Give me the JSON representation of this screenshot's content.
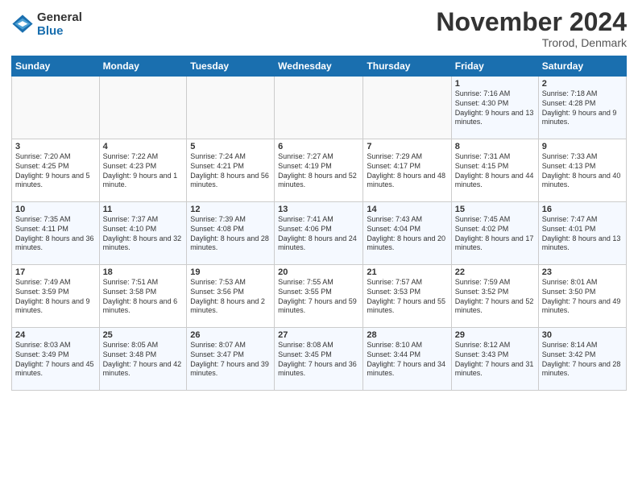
{
  "logo": {
    "general": "General",
    "blue": "Blue"
  },
  "title": "November 2024",
  "location": "Trorod, Denmark",
  "days_header": [
    "Sunday",
    "Monday",
    "Tuesday",
    "Wednesday",
    "Thursday",
    "Friday",
    "Saturday"
  ],
  "weeks": [
    [
      {
        "day": "",
        "data": ""
      },
      {
        "day": "",
        "data": ""
      },
      {
        "day": "",
        "data": ""
      },
      {
        "day": "",
        "data": ""
      },
      {
        "day": "",
        "data": ""
      },
      {
        "day": "1",
        "data": "Sunrise: 7:16 AM\nSunset: 4:30 PM\nDaylight: 9 hours and 13 minutes."
      },
      {
        "day": "2",
        "data": "Sunrise: 7:18 AM\nSunset: 4:28 PM\nDaylight: 9 hours and 9 minutes."
      }
    ],
    [
      {
        "day": "3",
        "data": "Sunrise: 7:20 AM\nSunset: 4:25 PM\nDaylight: 9 hours and 5 minutes."
      },
      {
        "day": "4",
        "data": "Sunrise: 7:22 AM\nSunset: 4:23 PM\nDaylight: 9 hours and 1 minute."
      },
      {
        "day": "5",
        "data": "Sunrise: 7:24 AM\nSunset: 4:21 PM\nDaylight: 8 hours and 56 minutes."
      },
      {
        "day": "6",
        "data": "Sunrise: 7:27 AM\nSunset: 4:19 PM\nDaylight: 8 hours and 52 minutes."
      },
      {
        "day": "7",
        "data": "Sunrise: 7:29 AM\nSunset: 4:17 PM\nDaylight: 8 hours and 48 minutes."
      },
      {
        "day": "8",
        "data": "Sunrise: 7:31 AM\nSunset: 4:15 PM\nDaylight: 8 hours and 44 minutes."
      },
      {
        "day": "9",
        "data": "Sunrise: 7:33 AM\nSunset: 4:13 PM\nDaylight: 8 hours and 40 minutes."
      }
    ],
    [
      {
        "day": "10",
        "data": "Sunrise: 7:35 AM\nSunset: 4:11 PM\nDaylight: 8 hours and 36 minutes."
      },
      {
        "day": "11",
        "data": "Sunrise: 7:37 AM\nSunset: 4:10 PM\nDaylight: 8 hours and 32 minutes."
      },
      {
        "day": "12",
        "data": "Sunrise: 7:39 AM\nSunset: 4:08 PM\nDaylight: 8 hours and 28 minutes."
      },
      {
        "day": "13",
        "data": "Sunrise: 7:41 AM\nSunset: 4:06 PM\nDaylight: 8 hours and 24 minutes."
      },
      {
        "day": "14",
        "data": "Sunrise: 7:43 AM\nSunset: 4:04 PM\nDaylight: 8 hours and 20 minutes."
      },
      {
        "day": "15",
        "data": "Sunrise: 7:45 AM\nSunset: 4:02 PM\nDaylight: 8 hours and 17 minutes."
      },
      {
        "day": "16",
        "data": "Sunrise: 7:47 AM\nSunset: 4:01 PM\nDaylight: 8 hours and 13 minutes."
      }
    ],
    [
      {
        "day": "17",
        "data": "Sunrise: 7:49 AM\nSunset: 3:59 PM\nDaylight: 8 hours and 9 minutes."
      },
      {
        "day": "18",
        "data": "Sunrise: 7:51 AM\nSunset: 3:58 PM\nDaylight: 8 hours and 6 minutes."
      },
      {
        "day": "19",
        "data": "Sunrise: 7:53 AM\nSunset: 3:56 PM\nDaylight: 8 hours and 2 minutes."
      },
      {
        "day": "20",
        "data": "Sunrise: 7:55 AM\nSunset: 3:55 PM\nDaylight: 7 hours and 59 minutes."
      },
      {
        "day": "21",
        "data": "Sunrise: 7:57 AM\nSunset: 3:53 PM\nDaylight: 7 hours and 55 minutes."
      },
      {
        "day": "22",
        "data": "Sunrise: 7:59 AM\nSunset: 3:52 PM\nDaylight: 7 hours and 52 minutes."
      },
      {
        "day": "23",
        "data": "Sunrise: 8:01 AM\nSunset: 3:50 PM\nDaylight: 7 hours and 49 minutes."
      }
    ],
    [
      {
        "day": "24",
        "data": "Sunrise: 8:03 AM\nSunset: 3:49 PM\nDaylight: 7 hours and 45 minutes."
      },
      {
        "day": "25",
        "data": "Sunrise: 8:05 AM\nSunset: 3:48 PM\nDaylight: 7 hours and 42 minutes."
      },
      {
        "day": "26",
        "data": "Sunrise: 8:07 AM\nSunset: 3:47 PM\nDaylight: 7 hours and 39 minutes."
      },
      {
        "day": "27",
        "data": "Sunrise: 8:08 AM\nSunset: 3:45 PM\nDaylight: 7 hours and 36 minutes."
      },
      {
        "day": "28",
        "data": "Sunrise: 8:10 AM\nSunset: 3:44 PM\nDaylight: 7 hours and 34 minutes."
      },
      {
        "day": "29",
        "data": "Sunrise: 8:12 AM\nSunset: 3:43 PM\nDaylight: 7 hours and 31 minutes."
      },
      {
        "day": "30",
        "data": "Sunrise: 8:14 AM\nSunset: 3:42 PM\nDaylight: 7 hours and 28 minutes."
      }
    ]
  ]
}
